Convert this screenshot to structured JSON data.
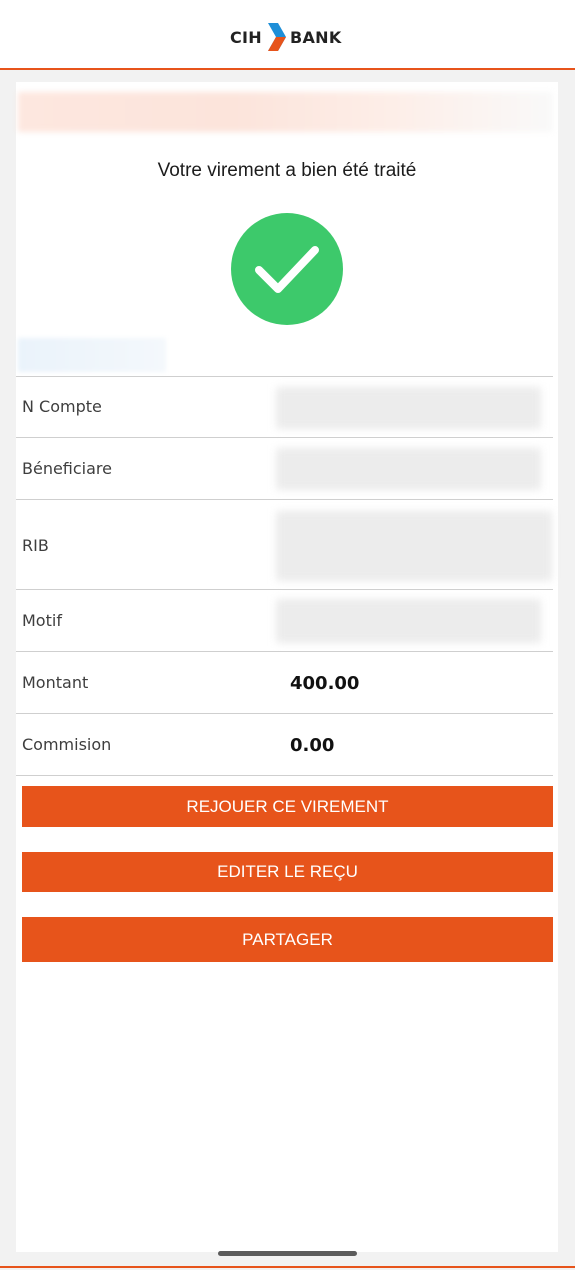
{
  "header": {
    "brand_left": "CIH",
    "brand_right": "BANK",
    "accent_color": "#e7541b"
  },
  "confirmation": {
    "message": "Votre virement a bien été traité",
    "status_icon": "check-icon",
    "status_color": "#3dc96b"
  },
  "details": {
    "account_label": "N Compte",
    "beneficiary_label": "Béneficiare",
    "rib_label": "RIB",
    "motif_label": "Motif",
    "amount_label": "Montant",
    "amount_value": "400.00",
    "commission_label": "Commision",
    "commission_value": "0.00"
  },
  "actions": {
    "replay_label": "REJOUER CE VIREMENT",
    "receipt_label": "EDITER LE REÇU",
    "share_label": "PARTAGER"
  }
}
